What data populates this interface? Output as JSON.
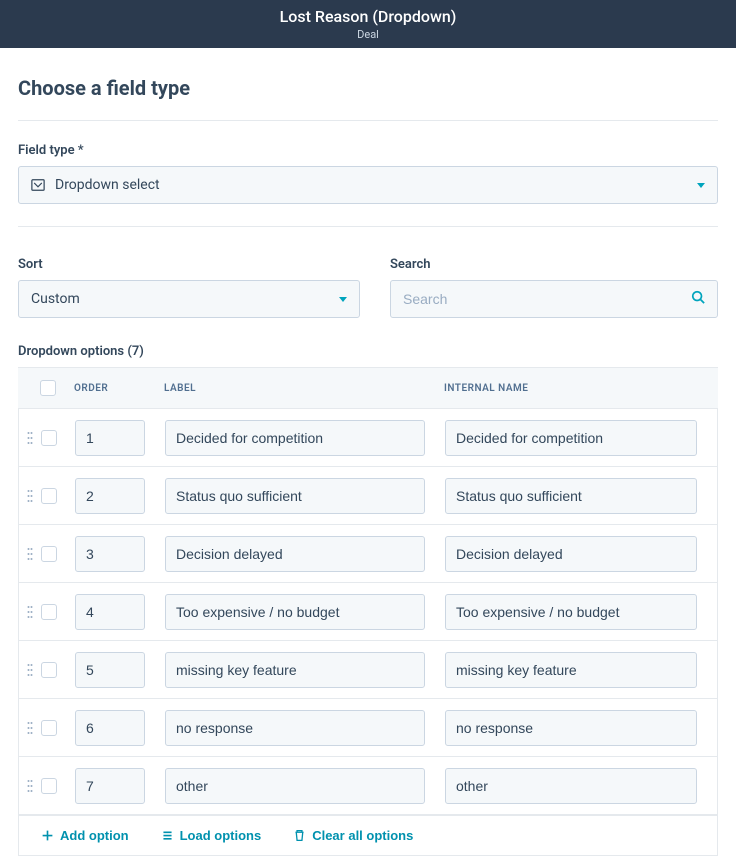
{
  "header": {
    "title": "Lost Reason (Dropdown)",
    "subtitle": "Deal"
  },
  "section": {
    "title": "Choose a field type",
    "fieldTypeLabel": "Field type *",
    "fieldTypeValue": "Dropdown select",
    "sortLabel": "Sort",
    "sortValue": "Custom",
    "searchLabel": "Search",
    "searchPlaceholder": "Search",
    "optionsHeading": "Dropdown options (7)"
  },
  "columns": {
    "order": "Order",
    "label": "Label",
    "internal": "Internal Name"
  },
  "rows": [
    {
      "order": "1",
      "label": "Decided for competition",
      "internal": "Decided for competition"
    },
    {
      "order": "2",
      "label": "Status quo sufficient",
      "internal": "Status quo sufficient"
    },
    {
      "order": "3",
      "label": "Decision delayed",
      "internal": "Decision delayed"
    },
    {
      "order": "4",
      "label": "Too expensive / no budget",
      "internal": "Too expensive / no budget"
    },
    {
      "order": "5",
      "label": "missing key feature",
      "internal": "missing key feature"
    },
    {
      "order": "6",
      "label": "no response",
      "internal": "no response"
    },
    {
      "order": "7",
      "label": "other",
      "internal": "other"
    }
  ],
  "actions": {
    "add": "Add option",
    "load": "Load options",
    "clear": "Clear all options"
  }
}
